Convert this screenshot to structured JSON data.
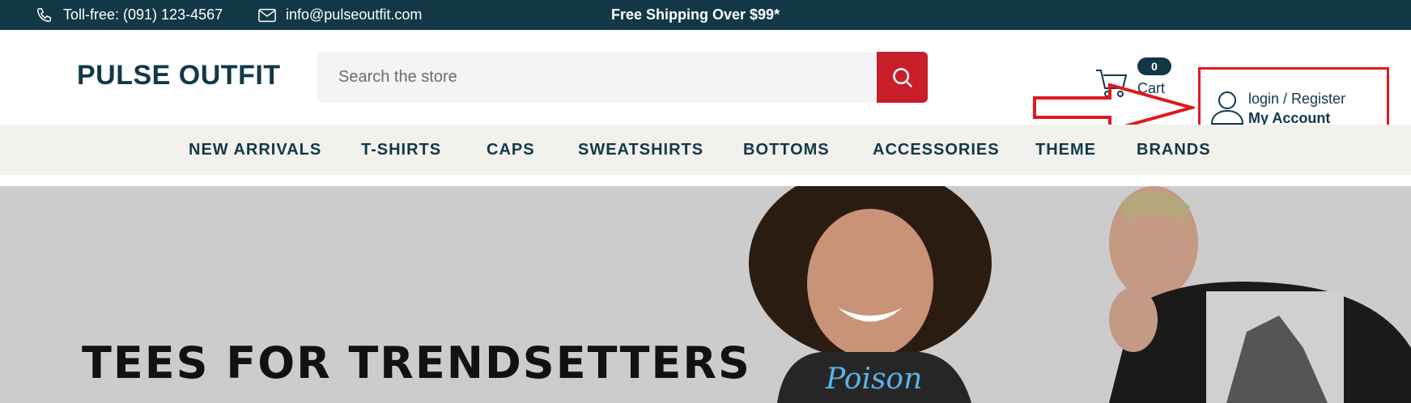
{
  "topbar": {
    "phone_text": "Toll-free: (091) 123-4567",
    "email_text": "info@pulseoutfit.com",
    "shipping_text": "Free Shipping Over $99*"
  },
  "header": {
    "logo": "PULSE OUTFIT",
    "search_placeholder": "Search the store",
    "cart_count": "0",
    "cart_label": "Cart",
    "account_line1": "login / Register",
    "account_line2": "My Account"
  },
  "nav": {
    "items": [
      "NEW ARRIVALS",
      "T-SHIRTS",
      "CAPS",
      "SWEATSHIRTS",
      "BOTTOMS",
      "ACCESSORIES",
      "THEME",
      "BRANDS"
    ]
  },
  "hero": {
    "title": "TEES FOR TRENDSETTERS"
  },
  "colors": {
    "topbar_bg": "#123848",
    "search_button": "#c81e2a",
    "annotation_red": "#e0191e",
    "nav_bg": "#f2f1ed",
    "hero_bg": "#cccccc"
  },
  "icons": [
    "phone-icon",
    "mail-icon",
    "search-icon",
    "cart-icon",
    "user-icon",
    "annotation-arrow"
  ]
}
